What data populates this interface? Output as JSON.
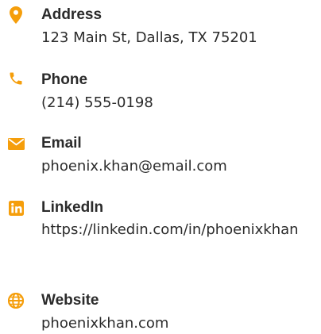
{
  "theme": {
    "accent": "#f59e0b",
    "text": "#2b2b2b",
    "background": "#ffffff"
  },
  "contacts": [
    {
      "label": "Address",
      "value": "123 Main St, Dallas, TX 75201",
      "icon": "map-pin-icon"
    },
    {
      "label": "Phone",
      "value": "(214) 555-0198",
      "icon": "phone-icon"
    },
    {
      "label": "Email",
      "value": "phoenix.khan@email.com",
      "icon": "envelope-icon"
    },
    {
      "label": "LinkedIn",
      "value": "https://linkedin.com/in/phoenixkhan",
      "icon": "linkedin-icon"
    },
    {
      "label": "Website",
      "value": "phoenixkhan.com",
      "icon": "globe-icon"
    }
  ]
}
